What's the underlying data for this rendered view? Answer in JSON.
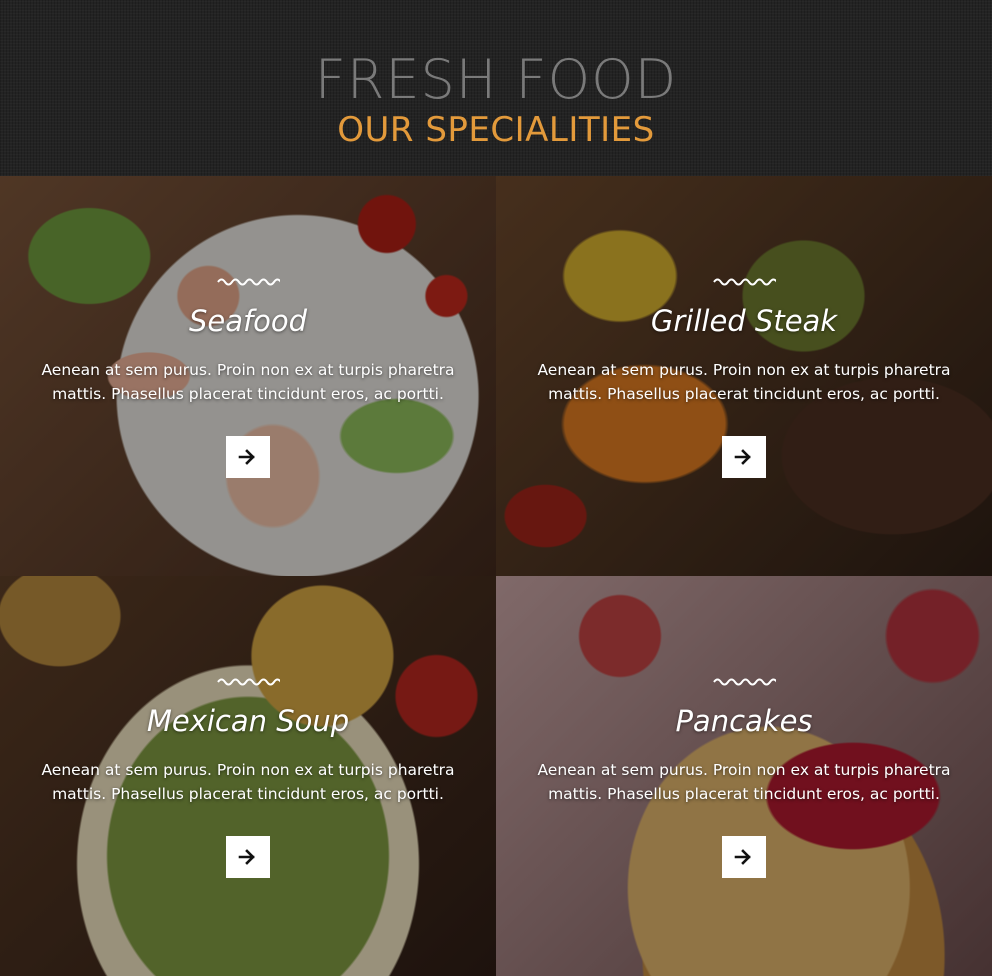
{
  "header": {
    "title": "FRESH FOOD",
    "subtitle": "OUR SPECIALITIES"
  },
  "colors": {
    "accent": "#e39a3b",
    "title_gray": "#7a7a7a",
    "header_bg": "#232323"
  },
  "cards": [
    {
      "title": "Seafood",
      "description": "Aenean at sem purus. Proin non ex at turpis pharetra mattis. Phasellus placerat tincidunt eros, ac portti.",
      "icon": "arrow-right-icon"
    },
    {
      "title": "Grilled Steak",
      "description": "Aenean at sem purus. Proin non ex at turpis pharetra mattis. Phasellus placerat tincidunt eros, ac portti.",
      "icon": "arrow-right-icon"
    },
    {
      "title": "Mexican Soup",
      "description": "Aenean at sem purus. Proin non ex at turpis pharetra mattis. Phasellus placerat tincidunt eros, ac portti.",
      "icon": "arrow-right-icon"
    },
    {
      "title": "Pancakes",
      "description": "Aenean at sem purus. Proin non ex at turpis pharetra mattis. Phasellus placerat tincidunt eros, ac portti.",
      "icon": "arrow-right-icon"
    }
  ]
}
